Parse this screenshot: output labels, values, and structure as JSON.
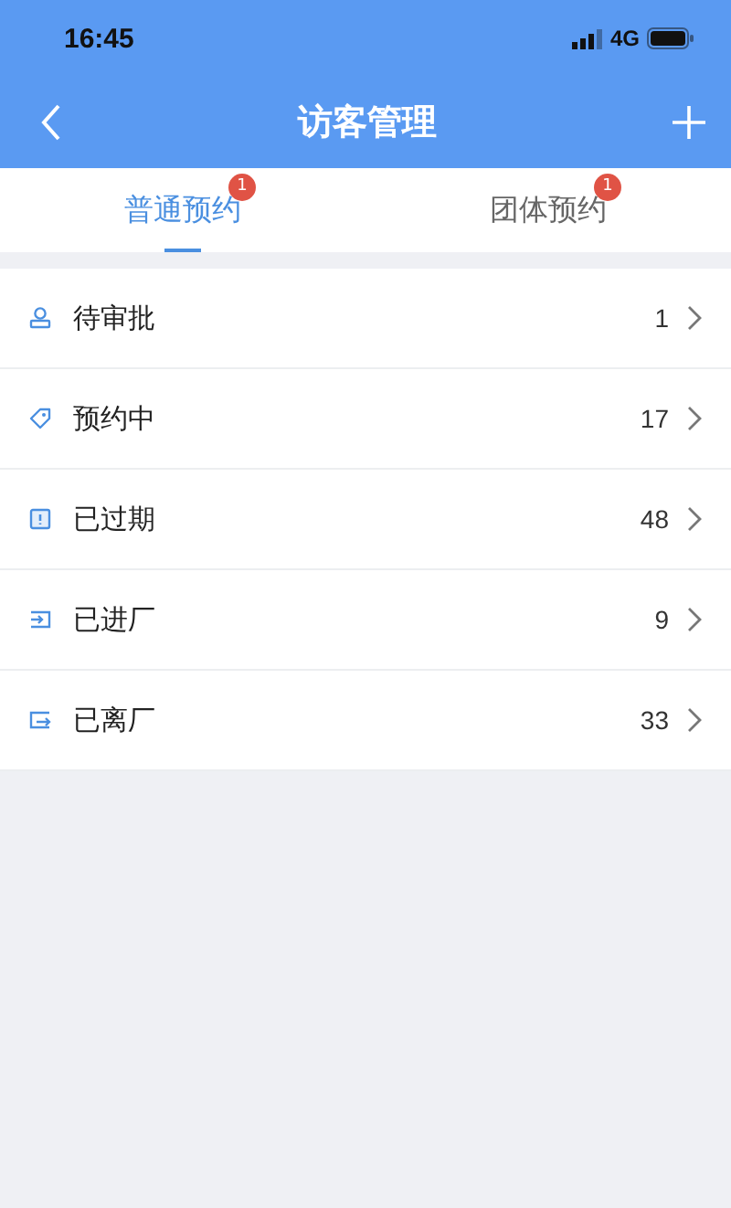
{
  "status_bar": {
    "time": "16:45",
    "network": "4G"
  },
  "nav": {
    "title": "访客管理"
  },
  "tabs": [
    {
      "label": "普通预约",
      "badge": "1",
      "selected": true
    },
    {
      "label": "团体预约",
      "badge": "1",
      "selected": false
    }
  ],
  "items": [
    {
      "kind": "person",
      "label": "待审批",
      "count": "1"
    },
    {
      "kind": "tag",
      "label": "预约中",
      "count": "17"
    },
    {
      "kind": "alert",
      "label": "已过期",
      "count": "48"
    },
    {
      "kind": "enter",
      "label": "已进厂",
      "count": "9"
    },
    {
      "kind": "exit",
      "label": "已离厂",
      "count": "33"
    }
  ]
}
